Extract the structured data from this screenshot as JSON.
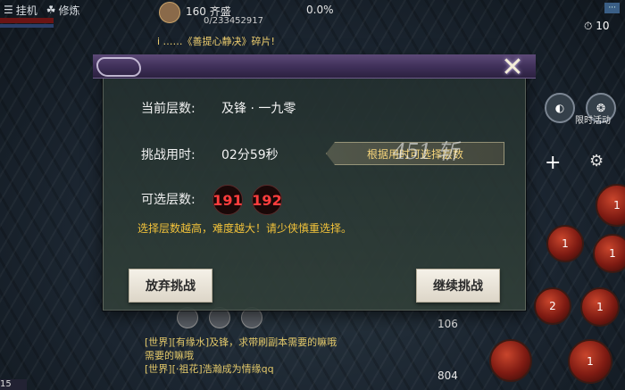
{
  "topbar": {
    "afk_label": "挂机",
    "cultivate_label": "修炼"
  },
  "player": {
    "level_name": "160   齐盛",
    "uid": "0/233452917",
    "percent": "0.0%"
  },
  "broadcast": "i  ……《善提心静决》碎片!",
  "top_right": {
    "badge": "···",
    "clock": "10"
  },
  "right_panel": {
    "event_label": "限时活动",
    "skill_counts": [
      "1",
      "1",
      "1",
      "2",
      "1",
      "1"
    ]
  },
  "modal": {
    "current_floor_label": "当前层数:",
    "current_floor_value": "及锋 · 一九零",
    "time_label": "挑战用时:",
    "time_value": "02分59秒",
    "time_hint": "根据用时可选择层数",
    "selectable_label": "可选层数:",
    "floors": [
      "191",
      "192"
    ],
    "warning": "选择层数越高，难度越大！请少侠慎重选择。",
    "give_up_label": "放弃挑战",
    "continue_label": "继续挑战",
    "close_symbol": "✕"
  },
  "watermark": "451 斩",
  "chat": {
    "lines": [
      "[世界][有缘水]及锋，求带刷副本需要的嘛哦",
      "需要的嘛哦",
      "[世界][·祖花]浩瀚成为情缘qq"
    ]
  },
  "counters": {
    "a": "106",
    "b": "804"
  },
  "bottom_left": "15"
}
